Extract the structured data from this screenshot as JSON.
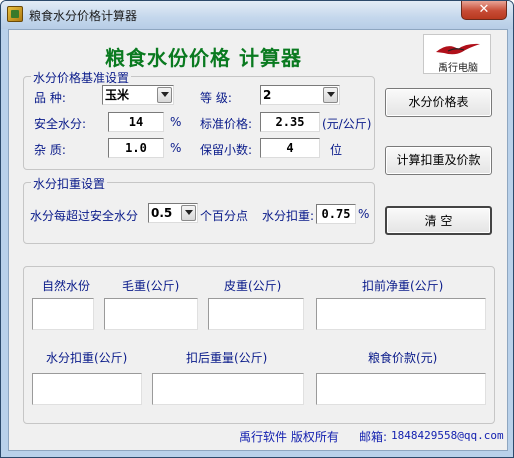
{
  "window": {
    "title": "粮食水分价格计算器",
    "close_label": "✕"
  },
  "header": {
    "title": "粮食水份价格  计算器",
    "logo_text": "禹行电脑",
    "logo_icon": "flying-bird-logo"
  },
  "base_settings": {
    "title": "水分价格基准设置",
    "variety_label": "品    种:",
    "variety_value": "玉米",
    "grade_label": "等    级:",
    "grade_value": "2",
    "safe_moisture_label": "安全水分:",
    "safe_moisture_value": "14",
    "safe_moisture_unit": "%",
    "standard_price_label": "标准价格:",
    "standard_price_value": "2.35",
    "standard_price_unit": "(元/公斤)",
    "impurity_label": "杂    质:",
    "impurity_value": "1.0",
    "impurity_unit": "%",
    "decimals_label": "保留小数:",
    "decimals_value": "4",
    "decimals_unit": "位"
  },
  "deduction_settings": {
    "title": "水分扣重设置",
    "per_label": "水分每超过安全水分",
    "per_value": "0.5",
    "per_unit": "个百分点",
    "deduct_label": "水分扣重:",
    "deduct_value": "0.75",
    "deduct_unit": "%"
  },
  "buttons": {
    "moisture_table": "水分价格表",
    "calculate": "计算扣重及价款",
    "clear": "清      空"
  },
  "results": {
    "natural_moisture": "自然水份",
    "gross_weight": "毛重(公斤)",
    "tare_weight": "皮重(公斤)",
    "net_before": "扣前净重(公斤)",
    "moisture_deduct": "水分扣重(公斤)",
    "net_after": "扣后重量(公斤)",
    "grain_payment": "粮食价款(元)"
  },
  "footer": {
    "copyright": "禹行软件  版权所有",
    "email_label": "邮箱:",
    "email_value": "1848429558@qq.com"
  },
  "colors": {
    "heading": "#0a7a20",
    "label": "#0a1b8a",
    "footer": "#1522b0",
    "window_frame": "#b9d1ea"
  }
}
